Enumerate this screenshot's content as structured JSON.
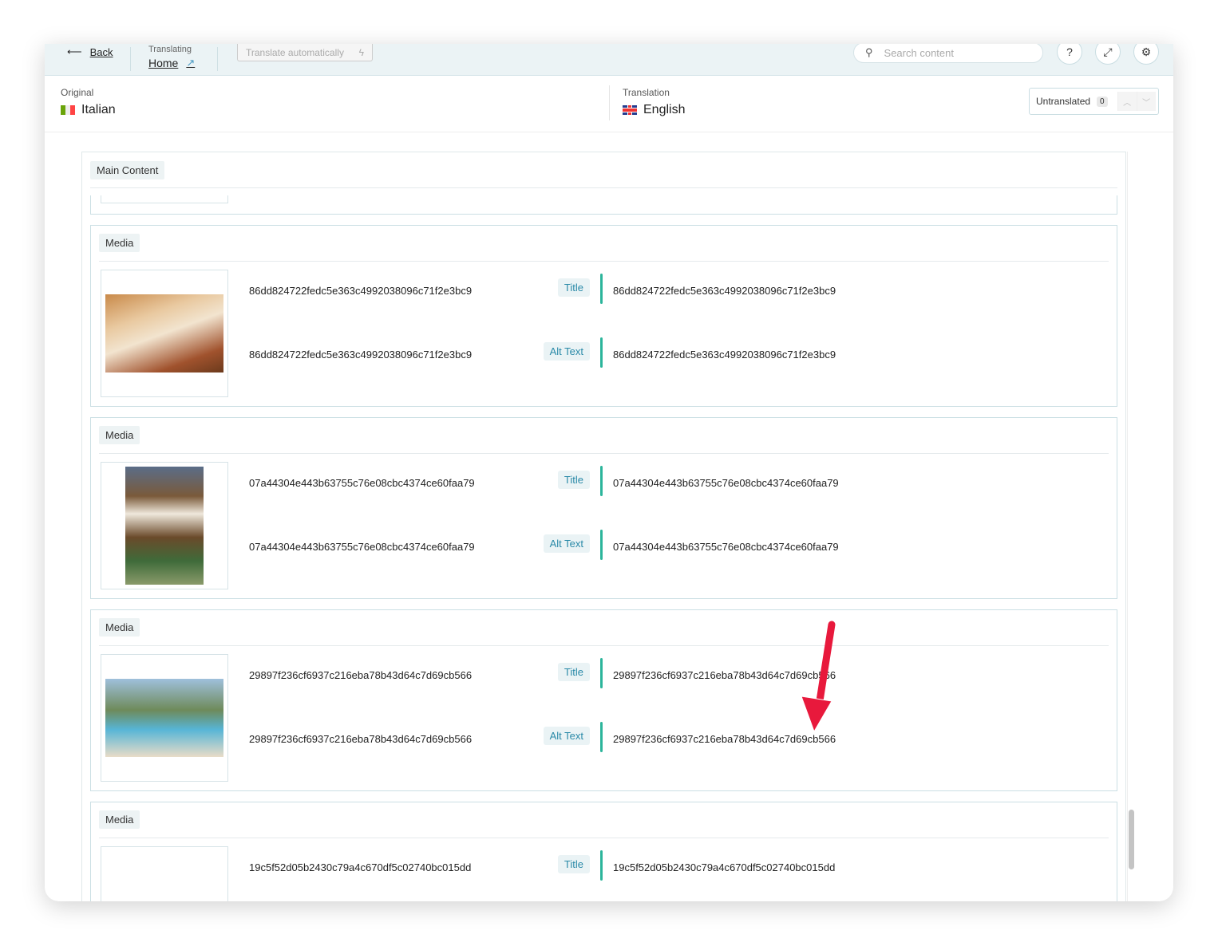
{
  "header": {
    "back_label": "Back",
    "translating_label": "Translating",
    "page_name": "Home",
    "translate_auto_label": "Translate automatically",
    "search_placeholder": "Search content"
  },
  "languages": {
    "original_label": "Original",
    "original_name": "Italian",
    "translation_label": "Translation",
    "translation_name": "English"
  },
  "untranslated": {
    "label": "Untranslated",
    "count": "0"
  },
  "section": {
    "title": "Main Content"
  },
  "media_label": "Media",
  "field_labels": {
    "title": "Title",
    "alt": "Alt Text"
  },
  "media": [
    {
      "original_title": "86dd824722fedc5e363c4992038096c71f2e3bc9",
      "original_alt": "86dd824722fedc5e363c4992038096c71f2e3bc9",
      "translated_title": "86dd824722fedc5e363c4992038096c71f2e3bc9",
      "translated_alt": "86dd824722fedc5e363c4992038096c71f2e3bc9"
    },
    {
      "original_title": "07a44304e443b63755c76e08cbc4374ce60faa79",
      "original_alt": "07a44304e443b63755c76e08cbc4374ce60faa79",
      "translated_title": "07a44304e443b63755c76e08cbc4374ce60faa79",
      "translated_alt": "07a44304e443b63755c76e08cbc4374ce60faa79"
    },
    {
      "original_title": "29897f236cf6937c216eba78b43d64c7d69cb566",
      "original_alt": "29897f236cf6937c216eba78b43d64c7d69cb566",
      "translated_title": "29897f236cf6937c216eba78b43d64c7d69cb566",
      "translated_alt": "29897f236cf6937c216eba78b43d64c7d69cb566"
    },
    {
      "original_title": "19c5f52d05b2430c79a4c670df5c02740bc015dd",
      "translated_title": "19c5f52d05b2430c79a4c670df5c02740bc015dd"
    }
  ],
  "colors": {
    "accent": "#2cb59b",
    "header_bg": "#ebf3f5",
    "annotation": "#e8193c"
  }
}
